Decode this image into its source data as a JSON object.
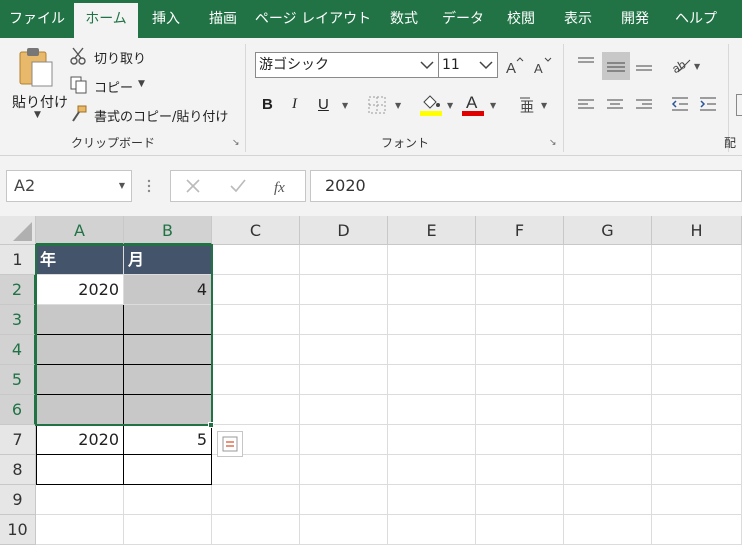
{
  "tabs": [
    {
      "label": "ファイル",
      "active": false
    },
    {
      "label": "ホーム",
      "active": true
    },
    {
      "label": "挿入",
      "active": false
    },
    {
      "label": "描画",
      "active": false
    },
    {
      "label": "ページ レイアウト",
      "active": false
    },
    {
      "label": "数式",
      "active": false
    },
    {
      "label": "データ",
      "active": false
    },
    {
      "label": "校閲",
      "active": false
    },
    {
      "label": "表示",
      "active": false
    },
    {
      "label": "開発",
      "active": false
    },
    {
      "label": "ヘルプ",
      "active": false
    }
  ],
  "clipboard": {
    "paste_label": "貼り付け",
    "cut_label": "切り取り",
    "copy_label": "コピー",
    "format_painter_label": "書式のコピー/貼り付け",
    "group_label": "クリップボード"
  },
  "font": {
    "font_name": "游ゴシック",
    "font_size": "11",
    "bold": "B",
    "italic": "I",
    "underline": "U",
    "group_label": "フォント"
  },
  "alignment": {
    "group_label_partial": "配"
  },
  "formula_bar": {
    "name_box": "A2",
    "formula_value": "2020"
  },
  "sheet": {
    "columns": [
      "A",
      "B",
      "C",
      "D",
      "E",
      "F",
      "G",
      "H"
    ],
    "rows": [
      "1",
      "2",
      "3",
      "4",
      "5",
      "6",
      "7",
      "8",
      "9",
      "10"
    ],
    "header": {
      "A": "年",
      "B": "月"
    },
    "row2": {
      "A": "2020",
      "B": "4"
    },
    "row7": {
      "A": "2020",
      "B": "5"
    }
  },
  "colors": {
    "accent": "#217346",
    "header_fill": "#44546a",
    "selection_fill": "#c8c8c8",
    "highlight_yellow": "#ffff00",
    "font_red": "#e00000"
  }
}
